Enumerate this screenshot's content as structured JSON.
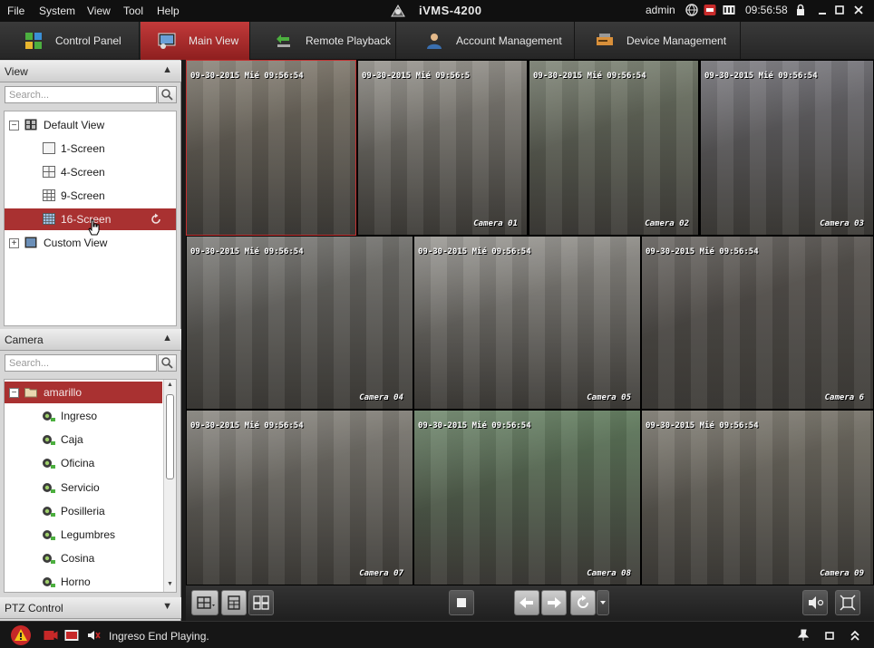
{
  "menubar": {
    "menus": [
      "File",
      "System",
      "View",
      "Tool",
      "Help"
    ],
    "app_title": "iVMS-4200",
    "user": "admin",
    "clock": "09:56:58"
  },
  "tabs": [
    {
      "label": "Control Panel",
      "icon": "grid-tiles-icon",
      "active": false
    },
    {
      "label": "Main View",
      "icon": "monitor-camera-icon",
      "active": true
    },
    {
      "label": "Remote Playback",
      "icon": "playback-arrow-icon",
      "active": false
    },
    {
      "label": "Account Management",
      "icon": "user-icon",
      "active": false
    },
    {
      "label": "Device Management",
      "icon": "device-icon",
      "active": false
    }
  ],
  "view_panel": {
    "title": "View",
    "search_placeholder": "Search...",
    "items": [
      {
        "label": "Default View",
        "level": 0,
        "expander": "−"
      },
      {
        "label": "1-Screen",
        "level": 1
      },
      {
        "label": "4-Screen",
        "level": 1
      },
      {
        "label": "9-Screen",
        "level": 1
      },
      {
        "label": "16-Screen",
        "level": 1,
        "selected": true
      },
      {
        "label": "Custom View",
        "level": 0,
        "expander": "+"
      }
    ]
  },
  "camera_panel": {
    "title": "Camera",
    "search_placeholder": "Search...",
    "group": {
      "label": "amarillo",
      "expander": "−"
    },
    "cameras": [
      "Ingreso",
      "Caja",
      "Oficina",
      "Servicio",
      "Posilleria",
      "Legumbres",
      "Cosina",
      "Horno"
    ]
  },
  "ptz_panel": {
    "title": "PTZ Control"
  },
  "video_cells": [
    {
      "osd": "09-30-2015 Mié 09:56:54",
      "camera": "",
      "scene": "#7b7468"
    },
    {
      "osd": "09-30-2015 Mié 09:56:5",
      "camera": "Camera 01",
      "scene": "#8a8780"
    },
    {
      "osd": "09-30-2015 Mié 09:56:54",
      "camera": "Camera 02",
      "scene": "#6f7666"
    },
    {
      "osd": "09-30-2015 Mié 09:56:54",
      "camera": "Camera 03",
      "scene": "#6e6d73"
    },
    {
      "osd": "09-30-2015 Mié 09:56:54",
      "camera": "Camera 04",
      "scene": "#6f6e6a"
    },
    {
      "osd": "09-30-2015 Mié 09:56:54",
      "camera": "Camera 05",
      "scene": "#8d8b86"
    },
    {
      "osd": "09-30-2015 Mié 09:56:54",
      "camera": "Camera 6",
      "scene": "#585450"
    },
    {
      "osd": "09-30-2015 Mié 09:56:54",
      "camera": "Camera 07",
      "scene": "#7d7a73"
    },
    {
      "osd": "09-30-2015 Mié 09:56:54",
      "camera": "Camera 08",
      "scene": "#5f7a5c"
    },
    {
      "osd": "09-30-2015 Mié 09:56:54",
      "camera": "Camera 09",
      "scene": "#747066"
    }
  ],
  "status": {
    "message": "Ingreso End Playing."
  },
  "colors": {
    "accent_red": "#a93131",
    "tab_active": "#b53131",
    "chrome_dark": "#1f1f1f"
  }
}
